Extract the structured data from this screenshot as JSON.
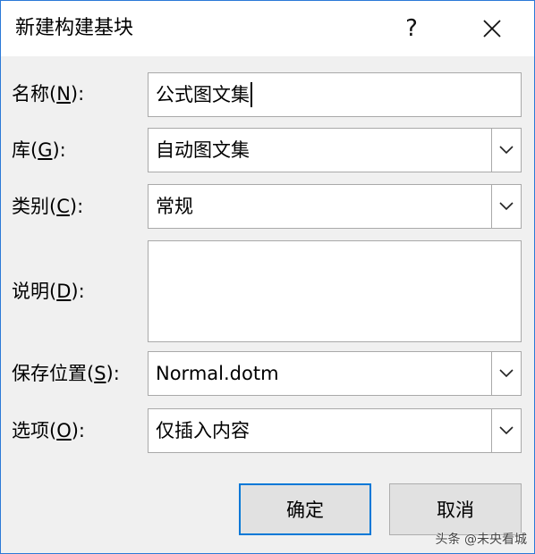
{
  "dialog": {
    "title": "新建构建基块",
    "help_glyph": "?"
  },
  "fields": {
    "name": {
      "label": "名称(",
      "accel": "N",
      "suffix": "):",
      "value": "公式图文集"
    },
    "gallery": {
      "label": "库(",
      "accel": "G",
      "suffix": "):",
      "value": "自动图文集"
    },
    "category": {
      "label": "类别(",
      "accel": "C",
      "suffix": "):",
      "value": "常规"
    },
    "description": {
      "label": "说明(",
      "accel": "D",
      "suffix": "):",
      "value": ""
    },
    "save_in": {
      "label": "保存位置(",
      "accel": "S",
      "suffix": "):",
      "value": "Normal.dotm"
    },
    "options": {
      "label": "选项(",
      "accel": "O",
      "suffix": "):",
      "value": "仅插入内容"
    }
  },
  "buttons": {
    "ok": "确定",
    "cancel": "取消"
  },
  "watermark": "头条 @未央看城",
  "colors": {
    "accent": "#0078d7",
    "window_border": "#2b79d7",
    "background": "#f0f0f0"
  }
}
